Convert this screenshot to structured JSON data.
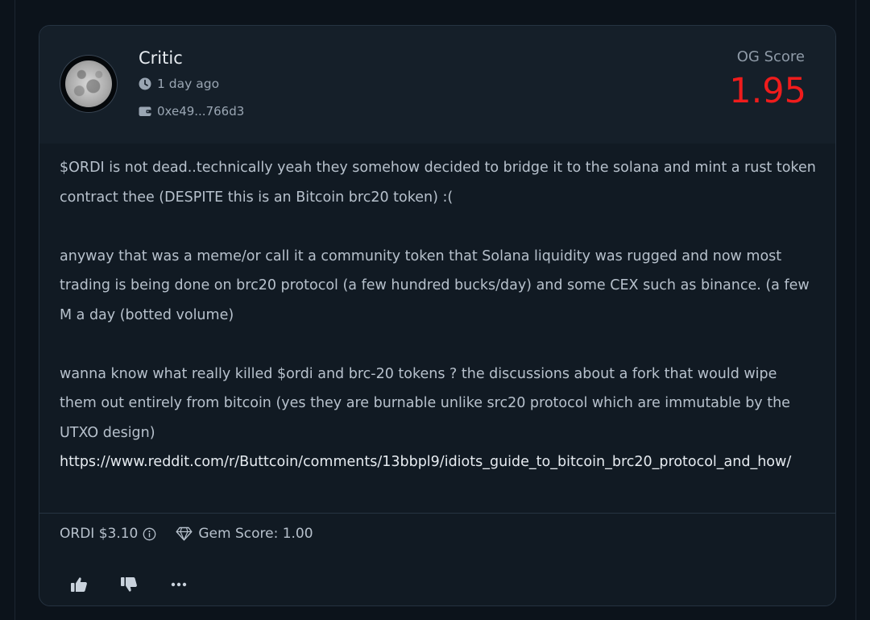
{
  "post": {
    "username": "Critic",
    "time_ago": "1 day ago",
    "wallet": "0xe49...766d3",
    "og_score_label": "OG Score",
    "og_score_value": "1.95",
    "paragraphs": [
      "$ORDI is not dead..technically yeah they somehow decided to bridge it to the solana and mint a rust token contract thee (DESPITE this is an Bitcoin brc20 token) :(",
      "anyway that was a meme/or call it a community token that Solana liquidity was rugged and now most trading is being done on brc20 protocol (a few hundred bucks/day) and some CEX such as binance. (a few M a day (botted volume)",
      "wanna know what really killed $ordi and brc-20 tokens ? the discussions about a fork that would wipe them out entirely from bitcoin (yes they are burnable unlike src20 protocol which are immutable by the UTXO design)"
    ],
    "link": "https://www.reddit.com/r/Buttcoin/comments/13bbpl9/idiots_guide_to_bitcoin_brc20_protocol_and_how/",
    "token_price": "ORDI $3.10",
    "gem_score": "Gem Score: 1.00"
  },
  "icons": {
    "avatar": "moon-avatar",
    "time": "clock-icon",
    "wallet": "wallet-icon",
    "info": "info-icon",
    "gem": "diamond-icon",
    "like": "thumbs-up-icon",
    "dislike": "thumbs-down-icon",
    "more": "more-icon"
  },
  "colors": {
    "background": "#0c131b",
    "card": "#111a23",
    "score": "#ef1c1c",
    "text": "#b7c1cc"
  }
}
